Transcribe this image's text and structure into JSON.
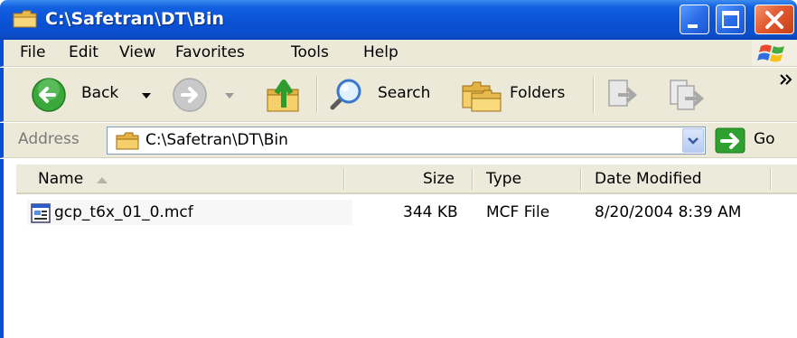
{
  "window": {
    "title": "C:\\Safetran\\DT\\Bin"
  },
  "menu": {
    "items": [
      "File",
      "Edit",
      "View",
      "Favorites",
      "Tools",
      "Help"
    ]
  },
  "toolbar": {
    "back_label": "Back",
    "search_label": "Search",
    "folders_label": "Folders"
  },
  "address": {
    "label": "Address",
    "value": "C:\\Safetran\\DT\\Bin",
    "go_label": "Go"
  },
  "columns": [
    "Name",
    "Size",
    "Type",
    "Date Modified"
  ],
  "files": [
    {
      "name": "gcp_t6x_01_0.mcf",
      "size": "344 KB",
      "type": "MCF File",
      "modified": "8/20/2004 8:39 AM"
    }
  ],
  "colors": {
    "titlebar": "#0a52d6",
    "chrome": "#ece9d8",
    "close_button": "#e35a30",
    "go_arrow": "#2fa12f"
  }
}
